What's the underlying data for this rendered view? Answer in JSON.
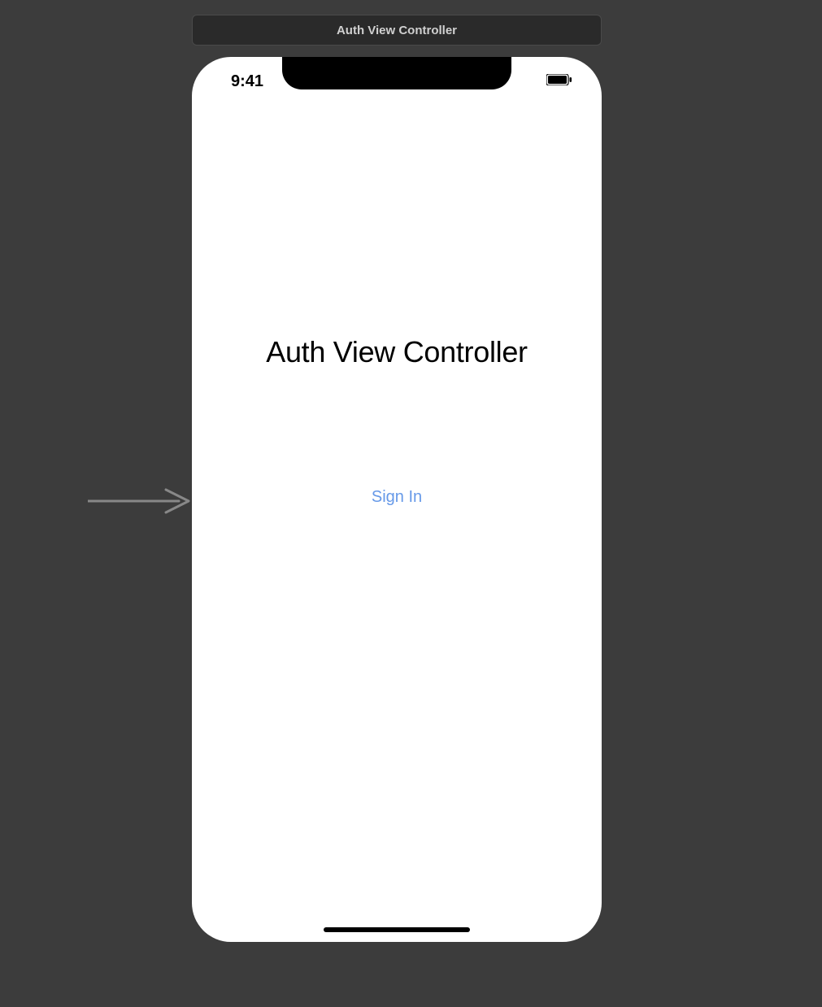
{
  "header": {
    "title": "Auth View Controller"
  },
  "statusBar": {
    "time": "9:41"
  },
  "screen": {
    "title": "Auth View Controller",
    "signInLabel": "Sign In"
  }
}
